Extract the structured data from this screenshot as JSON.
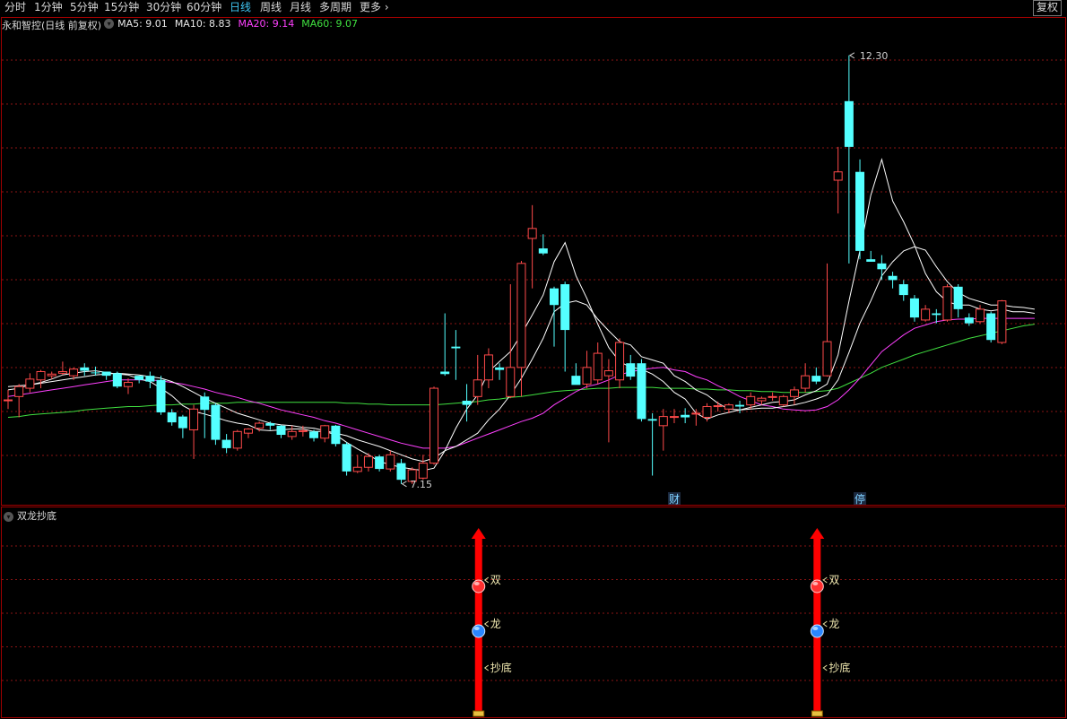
{
  "toolbar": {
    "periods": [
      "分时",
      "1分钟",
      "5分钟",
      "15分钟",
      "30分钟",
      "60分钟",
      "日线",
      "周线",
      "月线",
      "多周期"
    ],
    "active": "日线",
    "more_label": "更多",
    "adjust_label": "复权"
  },
  "legend": {
    "stock_name": "永和智控(日线 前复权)",
    "ma5": "MA5: 9.01",
    "ma10": "MA10: 8.83",
    "ma20": "MA20: 9.14",
    "ma60": "MA60: 9.07"
  },
  "indicator": {
    "name": "双龙抄底",
    "labels": [
      "双",
      "龙",
      "抄底"
    ]
  },
  "colors": {
    "up": "#ff4a4a",
    "down": "#54ffff",
    "ma5": "#ffffff",
    "ma10": "#ffffff",
    "ma20": "#ff40ff",
    "ma60": "#40e040",
    "signal": "#ff0000",
    "tab_active": "#3fc4f0"
  },
  "chart_data": {
    "type": "candlestick",
    "ylim": [
      6.9,
      12.75
    ],
    "high_label": "12.30",
    "low_label": "7.15",
    "markers": [
      {
        "index": 61,
        "text": "财"
      },
      {
        "index": 78,
        "text": "停"
      }
    ],
    "signals": [
      43,
      74
    ],
    "candles": [
      [
        8.15,
        8.16,
        8.28,
        8.05
      ],
      [
        8.2,
        8.32,
        8.35,
        7.95
      ],
      [
        8.3,
        8.41,
        8.48,
        8.25
      ],
      [
        8.4,
        8.5,
        8.52,
        8.3
      ],
      [
        8.45,
        8.47,
        8.5,
        8.41
      ],
      [
        8.48,
        8.5,
        8.62,
        8.46
      ],
      [
        8.45,
        8.53,
        8.55,
        8.4
      ],
      [
        8.55,
        8.51,
        8.6,
        8.45
      ],
      [
        8.49,
        8.48,
        8.56,
        8.45
      ],
      [
        8.5,
        8.45,
        8.5,
        8.4
      ],
      [
        8.48,
        8.32,
        8.5,
        8.3
      ],
      [
        8.32,
        8.37,
        8.42,
        8.23
      ],
      [
        8.45,
        8.4,
        8.45,
        8.36
      ],
      [
        8.45,
        8.38,
        8.5,
        8.3
      ],
      [
        8.4,
        8.01,
        8.45,
        7.98
      ],
      [
        8.01,
        7.89,
        8.05,
        7.85
      ],
      [
        7.96,
        7.82,
        7.98,
        7.7
      ],
      [
        7.8,
        8.05,
        8.1,
        7.45
      ],
      [
        8.2,
        8.04,
        8.25,
        7.7
      ],
      [
        8.1,
        7.68,
        8.12,
        7.62
      ],
      [
        7.68,
        7.58,
        7.75,
        7.52
      ],
      [
        7.58,
        7.78,
        7.8,
        7.55
      ],
      [
        7.76,
        7.81,
        7.82,
        7.7
      ],
      [
        7.82,
        7.88,
        7.9,
        7.78
      ],
      [
        7.88,
        7.85,
        7.9,
        7.8
      ],
      [
        7.85,
        7.74,
        7.86,
        7.7
      ],
      [
        7.72,
        7.78,
        7.85,
        7.68
      ],
      [
        7.78,
        7.79,
        7.85,
        7.72
      ],
      [
        7.78,
        7.7,
        7.8,
        7.66
      ],
      [
        7.7,
        7.85,
        7.86,
        7.65
      ],
      [
        7.85,
        7.63,
        7.86,
        7.6
      ],
      [
        7.63,
        7.3,
        7.65,
        7.25
      ],
      [
        7.3,
        7.35,
        7.5,
        7.28
      ],
      [
        7.35,
        7.48,
        7.52,
        7.3
      ],
      [
        7.48,
        7.33,
        7.5,
        7.3
      ],
      [
        7.33,
        7.5,
        7.55,
        7.3
      ],
      [
        7.4,
        7.2,
        7.45,
        7.15
      ],
      [
        7.18,
        7.32,
        7.35,
        7.15
      ],
      [
        7.22,
        7.4,
        7.5,
        7.2
      ],
      [
        7.4,
        8.3,
        8.32,
        7.38
      ],
      [
        8.5,
        8.47,
        9.2,
        8.45
      ],
      [
        8.8,
        8.78,
        9.0,
        8.4
      ],
      [
        8.15,
        8.1,
        8.35,
        7.9
      ],
      [
        8.2,
        8.4,
        8.7,
        8.1
      ],
      [
        8.4,
        8.7,
        8.78,
        8.3
      ],
      [
        8.55,
        8.52,
        8.6,
        8.4
      ],
      [
        8.2,
        8.55,
        9.55,
        8.18
      ],
      [
        8.55,
        9.8,
        9.83,
        8.2
      ],
      [
        10.1,
        10.22,
        10.5,
        9.5
      ],
      [
        9.98,
        9.92,
        10.15,
        9.9
      ],
      [
        9.5,
        9.3,
        9.52,
        8.8
      ],
      [
        9.55,
        9.0,
        9.58,
        8.5
      ],
      [
        8.45,
        8.34,
        8.6,
        8.35
      ],
      [
        8.35,
        8.55,
        8.75,
        8.3
      ],
      [
        8.4,
        8.72,
        8.85,
        8.35
      ],
      [
        8.45,
        8.51,
        8.65,
        7.65
      ],
      [
        8.4,
        8.85,
        8.9,
        8.3
      ],
      [
        8.6,
        8.44,
        8.7,
        8.4
      ],
      [
        8.6,
        7.93,
        8.65,
        7.9
      ],
      [
        7.93,
        7.91,
        8.0,
        7.25
      ],
      [
        7.85,
        7.96,
        8.05,
        7.55
      ],
      [
        7.95,
        7.96,
        8.05,
        7.88
      ],
      [
        7.98,
        7.95,
        8.06,
        7.88
      ],
      [
        8.0,
        8.0,
        8.05,
        7.85
      ],
      [
        7.95,
        8.08,
        8.12,
        7.9
      ],
      [
        8.08,
        8.09,
        8.14,
        8.02
      ],
      [
        8.05,
        8.1,
        8.12,
        8.0
      ],
      [
        8.1,
        8.08,
        8.15,
        8.0
      ],
      [
        8.1,
        8.2,
        8.25,
        8.05
      ],
      [
        8.15,
        8.18,
        8.2,
        8.1
      ],
      [
        8.2,
        8.2,
        8.25,
        8.15
      ],
      [
        8.1,
        8.2,
        8.22,
        8.08
      ],
      [
        8.2,
        8.28,
        8.32,
        8.1
      ],
      [
        8.3,
        8.45,
        8.6,
        8.25
      ],
      [
        8.45,
        8.38,
        8.55,
        8.35
      ],
      [
        8.45,
        8.86,
        9.8,
        8.44
      ],
      [
        10.8,
        10.9,
        11.2,
        10.4
      ],
      [
        11.75,
        11.2,
        12.3,
        9.8
      ],
      [
        10.9,
        9.95,
        11.05,
        9.85
      ],
      [
        9.85,
        9.82,
        9.95,
        9.82
      ],
      [
        9.8,
        9.73,
        9.9,
        9.6
      ],
      [
        9.65,
        9.6,
        9.7,
        9.5
      ],
      [
        9.55,
        9.42,
        9.6,
        9.35
      ],
      [
        9.38,
        9.15,
        9.42,
        9.1
      ],
      [
        9.12,
        9.25,
        9.3,
        9.1
      ],
      [
        9.2,
        9.18,
        9.25,
        9.08
      ],
      [
        9.12,
        9.52,
        9.55,
        9.1
      ],
      [
        9.52,
        9.25,
        9.55,
        9.15
      ],
      [
        9.15,
        9.08,
        9.2,
        9.05
      ],
      [
        9.1,
        9.25,
        9.3,
        9.08
      ],
      [
        9.2,
        8.88,
        9.22,
        8.85
      ],
      [
        8.85,
        9.35,
        9.36,
        8.83
      ]
    ],
    "ma5": [
      8.28,
      8.3,
      8.34,
      8.37,
      8.41,
      8.46,
      8.48,
      8.5,
      8.51,
      8.49,
      8.47,
      8.46,
      8.41,
      8.38,
      8.3,
      8.21,
      8.09,
      8.02,
      7.99,
      7.95,
      7.91,
      7.88,
      7.86,
      7.8,
      7.79,
      7.8,
      7.81,
      7.81,
      7.78,
      7.78,
      7.74,
      7.65,
      7.57,
      7.5,
      7.42,
      7.38,
      7.35,
      7.33,
      7.31,
      7.34,
      7.55,
      7.82,
      8.05,
      8.22,
      8.5,
      8.62,
      8.74,
      8.95,
      9.18,
      9.42,
      9.82,
      10.05,
      9.65,
      9.38,
      9.07,
      8.79,
      8.62,
      8.55,
      8.53,
      8.47,
      8.38,
      8.25,
      8.17,
      8.0,
      7.93,
      7.98,
      8.01,
      8.04,
      8.07,
      8.1,
      8.13,
      8.14,
      8.16,
      8.22,
      8.27,
      8.35,
      8.7,
      9.35,
      9.95,
      10.62,
      11.05,
      10.55,
      10.3,
      10.02,
      9.68,
      9.46,
      9.34,
      9.3,
      9.3,
      9.25,
      9.23,
      9.25,
      9.22,
      9.22,
      9.2
    ],
    "ma10": [
      8.32,
      8.33,
      8.34,
      8.36,
      8.38,
      8.4,
      8.42,
      8.44,
      8.46,
      8.47,
      8.48,
      8.47,
      8.46,
      8.44,
      8.42,
      8.38,
      8.32,
      8.25,
      8.18,
      8.12,
      8.06,
      8.0,
      7.96,
      7.92,
      7.88,
      7.86,
      7.85,
      7.83,
      7.82,
      7.79,
      7.76,
      7.73,
      7.68,
      7.64,
      7.6,
      7.55,
      7.5,
      7.45,
      7.42,
      7.46,
      7.55,
      7.6,
      7.68,
      7.76,
      7.92,
      8.05,
      8.22,
      8.42,
      8.65,
      8.9,
      9.22,
      9.32,
      9.35,
      9.3,
      9.13,
      8.99,
      8.86,
      8.82,
      8.68,
      8.64,
      8.6,
      8.45,
      8.38,
      8.28,
      8.22,
      8.12,
      8.05,
      8.04,
      8.05,
      8.06,
      8.06,
      8.08,
      8.1,
      8.13,
      8.17,
      8.22,
      8.4,
      8.73,
      9.08,
      9.35,
      9.65,
      9.82,
      9.95,
      10.0,
      9.96,
      9.76,
      9.58,
      9.45,
      9.38,
      9.34,
      9.3,
      9.3,
      9.28,
      9.27,
      9.25
    ],
    "ma20": [
      8.2,
      8.22,
      8.24,
      8.26,
      8.28,
      8.3,
      8.32,
      8.34,
      8.36,
      8.38,
      8.4,
      8.4,
      8.4,
      8.4,
      8.39,
      8.37,
      8.35,
      8.32,
      8.29,
      8.25,
      8.22,
      8.19,
      8.15,
      8.12,
      8.08,
      8.04,
      8.01,
      7.98,
      7.95,
      7.91,
      7.88,
      7.84,
      7.8,
      7.76,
      7.72,
      7.68,
      7.64,
      7.61,
      7.58,
      7.58,
      7.58,
      7.6,
      7.65,
      7.7,
      7.75,
      7.8,
      7.85,
      7.9,
      7.94,
      8.0,
      8.1,
      8.18,
      8.26,
      8.32,
      8.35,
      8.4,
      8.46,
      8.5,
      8.52,
      8.54,
      8.55,
      8.52,
      8.5,
      8.44,
      8.4,
      8.33,
      8.27,
      8.2,
      8.15,
      8.1,
      8.08,
      8.05,
      8.04,
      8.03,
      8.04,
      8.08,
      8.16,
      8.28,
      8.42,
      8.58,
      8.74,
      8.84,
      8.94,
      9.02,
      9.06,
      9.1,
      9.12,
      9.13,
      9.13,
      9.14,
      9.14,
      9.14,
      9.14,
      9.14,
      9.14
    ],
    "ma60": [
      7.95,
      7.96,
      7.98,
      7.99,
      8.0,
      8.01,
      8.02,
      8.04,
      8.05,
      8.06,
      8.07,
      8.08,
      8.08,
      8.09,
      8.1,
      8.1,
      8.11,
      8.11,
      8.12,
      8.12,
      8.12,
      8.13,
      8.13,
      8.13,
      8.13,
      8.13,
      8.13,
      8.13,
      8.13,
      8.13,
      8.13,
      8.12,
      8.12,
      8.11,
      8.11,
      8.1,
      8.1,
      8.1,
      8.1,
      8.1,
      8.11,
      8.12,
      8.13,
      8.14,
      8.16,
      8.17,
      8.19,
      8.2,
      8.22,
      8.24,
      8.26,
      8.27,
      8.28,
      8.29,
      8.3,
      8.3,
      8.31,
      8.31,
      8.31,
      8.31,
      8.3,
      8.3,
      8.3,
      8.29,
      8.29,
      8.28,
      8.28,
      8.27,
      8.27,
      8.26,
      8.26,
      8.25,
      8.25,
      8.25,
      8.26,
      8.27,
      8.3,
      8.36,
      8.42,
      8.48,
      8.55,
      8.6,
      8.65,
      8.7,
      8.74,
      8.78,
      8.82,
      8.86,
      8.9,
      8.93,
      8.96,
      8.99,
      9.02,
      9.05,
      9.07
    ]
  }
}
